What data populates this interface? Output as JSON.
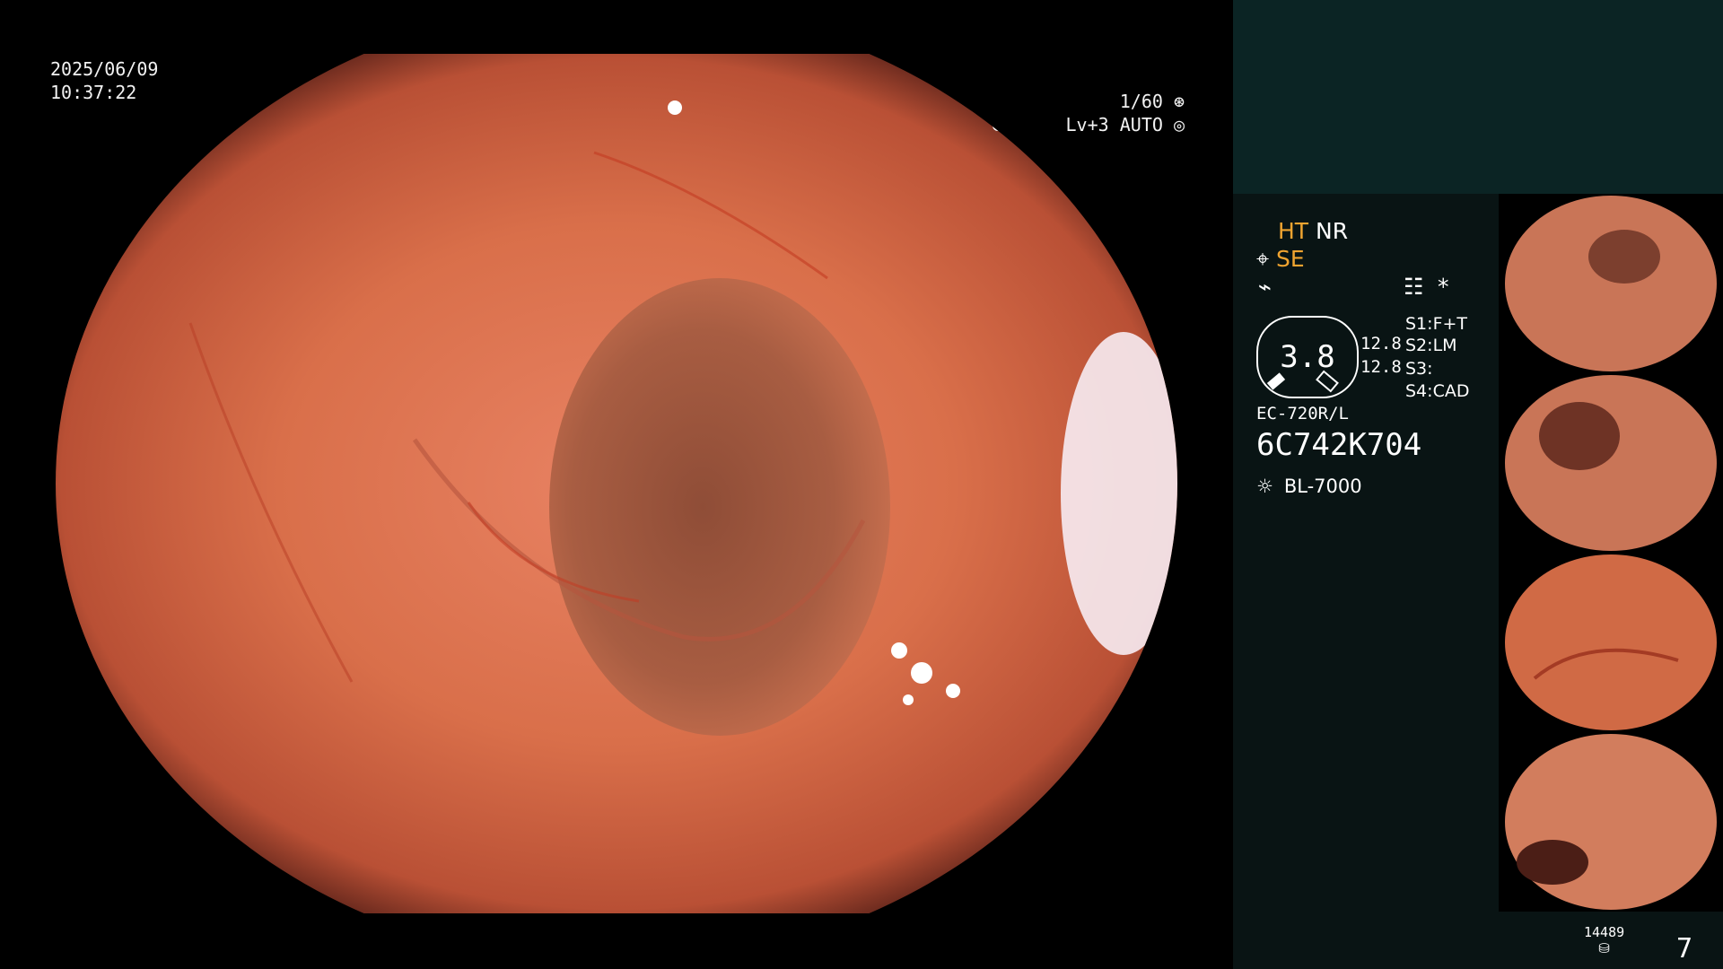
{
  "main": {
    "date": "2025/06/09",
    "time": "10:37:22",
    "shutter": "1/60",
    "level": "Lv+3",
    "exposure_mode": "AUTO"
  },
  "settings": {
    "ht": "HT",
    "nr": "NR",
    "se": "SE",
    "zoom": "3.8",
    "zoom_a": "12.8",
    "zoom_b": "12.8",
    "s1_label": "S1:",
    "s1_value": "F+T",
    "s2_label": "S2:",
    "s2_value": "LM",
    "s3_label": "S3:",
    "s3_value": "",
    "s4_label": "S4:",
    "s4_value": "CAD",
    "scope_model": "EC-720R/L",
    "serial": "6C742K704",
    "light_source": "BL-7000",
    "asterisk": "*"
  },
  "storage": {
    "count": "14489",
    "image_count": "7"
  },
  "icons": [
    "shutter-icon",
    "auto-exposure-icon",
    "scope-icon",
    "wave-icon",
    "menu-icon",
    "light-source-icon",
    "storage-icon"
  ],
  "colors": {
    "accent": "#f0a430",
    "top_panel": "#0b2424",
    "side_panel": "#091414",
    "tissue": "#d86f4d"
  }
}
